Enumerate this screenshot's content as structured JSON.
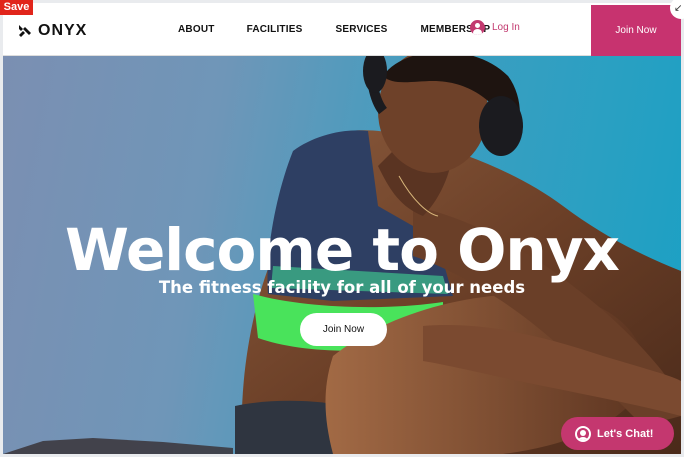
{
  "editor": {
    "save_label": "Save"
  },
  "header": {
    "brand": "ONYX",
    "nav": [
      "ABOUT",
      "FACILITIES",
      "SERVICES",
      "MEMBERSHIP"
    ],
    "login_label": "Log In",
    "join_label": "Join Now"
  },
  "hero": {
    "title": "Welcome to Onyx",
    "subtitle": "The fitness facility for all of your needs",
    "cta_label": "Join Now"
  },
  "chat": {
    "label": "Let's Chat!"
  },
  "colors": {
    "accent": "#c7336f",
    "hero_bg_left": "#7b8fb2",
    "hero_bg_right": "#1aa1c4",
    "text_dark": "#111111"
  },
  "icons": [
    "onyx-logo-icon",
    "user-icon",
    "chat-user-icon",
    "collapse-icon"
  ]
}
